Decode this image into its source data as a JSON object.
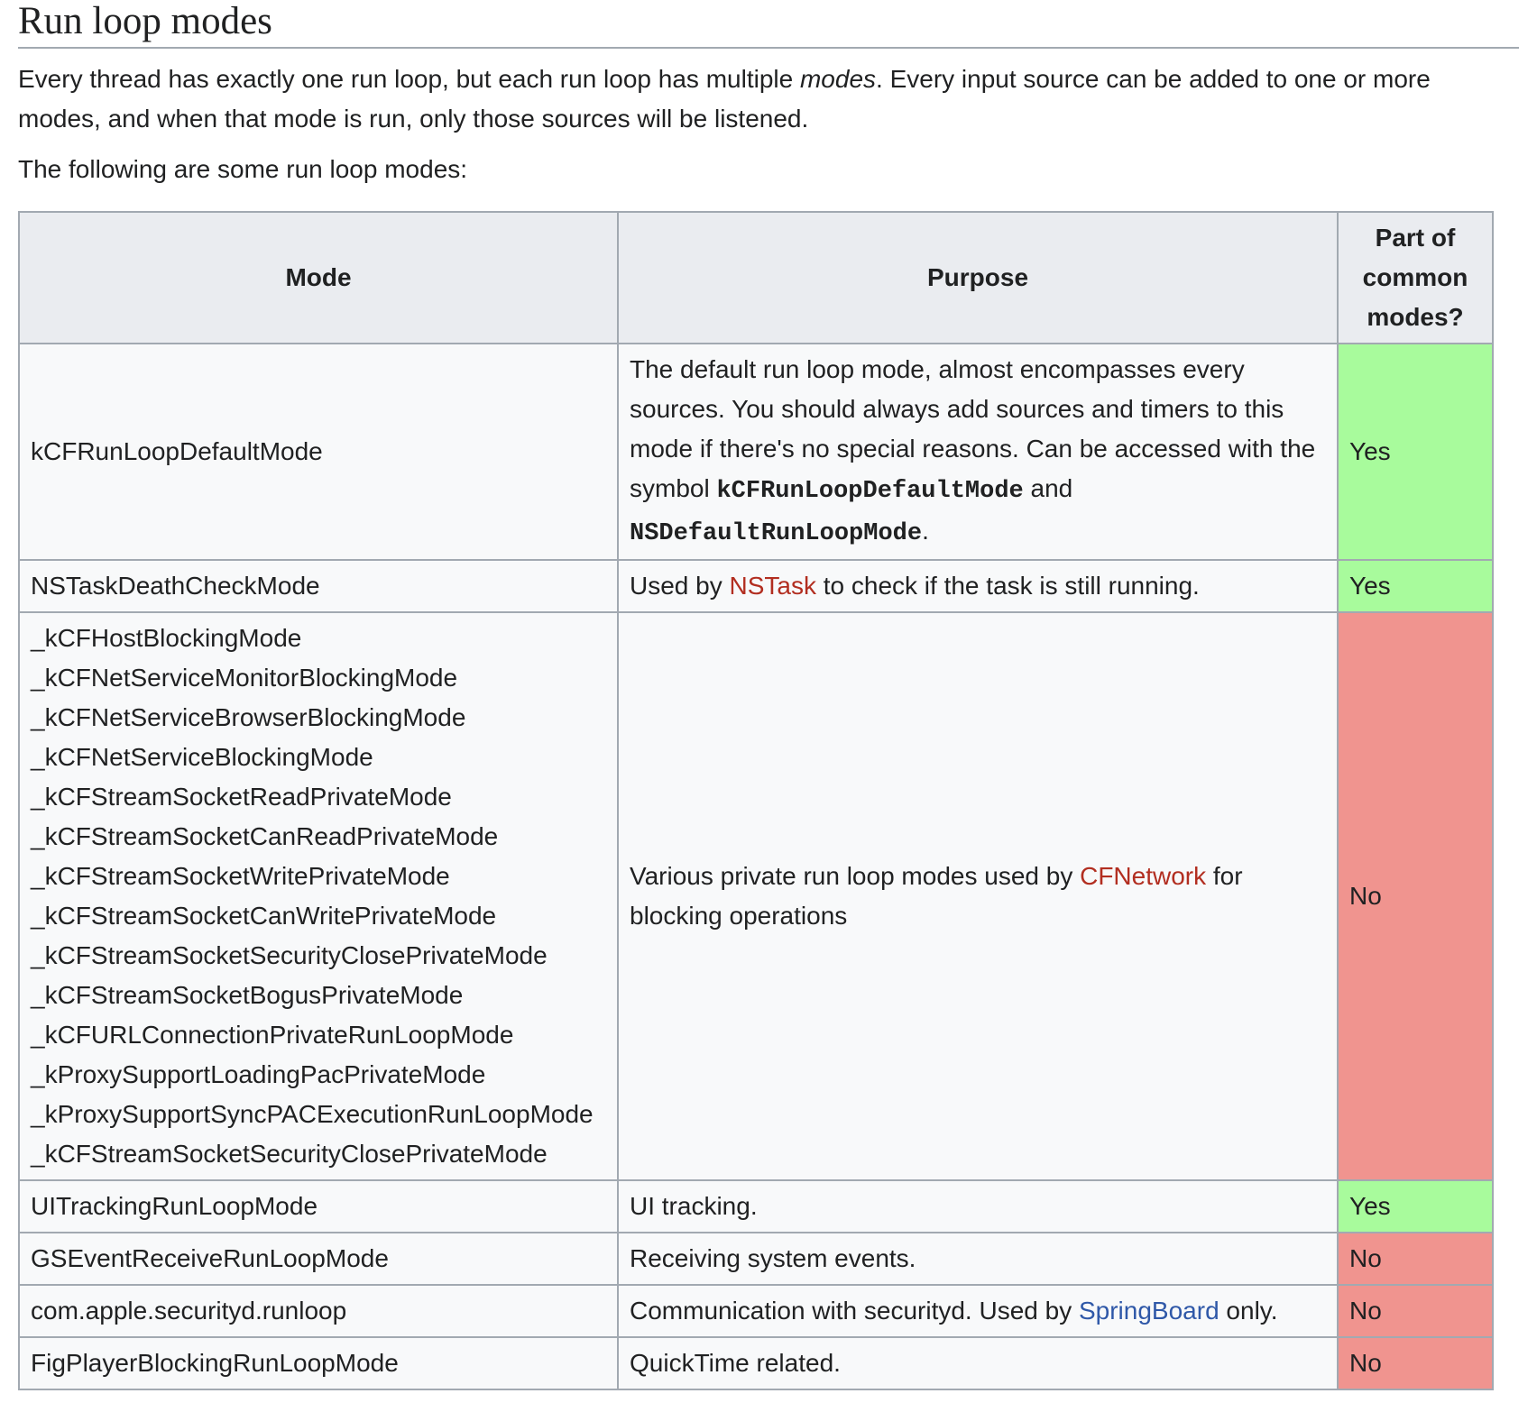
{
  "heading": "Run loop modes",
  "intro": {
    "part1": "Every thread has exactly one run loop, but each run loop has multiple ",
    "emphasis": "modes",
    "part2": ". Every input source can be added to one or more modes, and when that mode is run, only those sources will be listened."
  },
  "lead": "The following are some run loop modes:",
  "table": {
    "headers": {
      "mode": "Mode",
      "purpose": "Purpose",
      "common": "Part of common modes?"
    },
    "rows": [
      {
        "mode": "kCFRunLoopDefaultMode",
        "purpose_text1": "The default run loop mode, almost encompasses every sources. You should always add sources and timers to this mode if there's no special reasons. Can be accessed with the symbol ",
        "purpose_code1": "kCFRunLoopDefaultMode",
        "purpose_text2": " and ",
        "purpose_code2": "NSDefaultRunLoopMode",
        "purpose_text3": ".",
        "common": "Yes"
      },
      {
        "mode": "NSTaskDeathCheckMode",
        "purpose_text1": "Used by ",
        "purpose_link": "NSTask",
        "purpose_text2": " to check if the task is still running.",
        "common": "Yes"
      },
      {
        "modes": [
          "_kCFHostBlockingMode",
          "_kCFNetServiceMonitorBlockingMode",
          "_kCFNetServiceBrowserBlockingMode",
          "_kCFNetServiceBlockingMode",
          "_kCFStreamSocketReadPrivateMode",
          "_kCFStreamSocketCanReadPrivateMode",
          "_kCFStreamSocketWritePrivateMode",
          "_kCFStreamSocketCanWritePrivateMode",
          "_kCFStreamSocketSecurityClosePrivateMode",
          "_kCFStreamSocketBogusPrivateMode",
          "_kCFURLConnectionPrivateRunLoopMode",
          "_kProxySupportLoadingPacPrivateMode",
          "_kProxySupportSyncPACExecutionRunLoopMode",
          "_kCFStreamSocketSecurityClosePrivateMode"
        ],
        "purpose_text1": "Various private run loop modes used by ",
        "purpose_link": "CFNetwork",
        "purpose_text2": " for blocking operations",
        "common": "No"
      },
      {
        "mode": "UITrackingRunLoopMode",
        "purpose": "UI tracking.",
        "common": "Yes"
      },
      {
        "mode": "GSEventReceiveRunLoopMode",
        "purpose": "Receiving system events.",
        "common": "No"
      },
      {
        "mode": "com.apple.securityd.runloop",
        "purpose_text1": "Communication with securityd. Used by ",
        "purpose_link": "SpringBoard",
        "purpose_text2": " only.",
        "common": "No"
      },
      {
        "mode": "FigPlayerBlockingRunLoopMode",
        "purpose": "QuickTime related.",
        "common": "No"
      }
    ]
  },
  "colors": {
    "yes_cell": "#a8fb9c",
    "no_cell": "#f0948f",
    "header_bg": "#eaecf0",
    "red_link": "#b22e20",
    "blue_link": "#2f58a8"
  }
}
